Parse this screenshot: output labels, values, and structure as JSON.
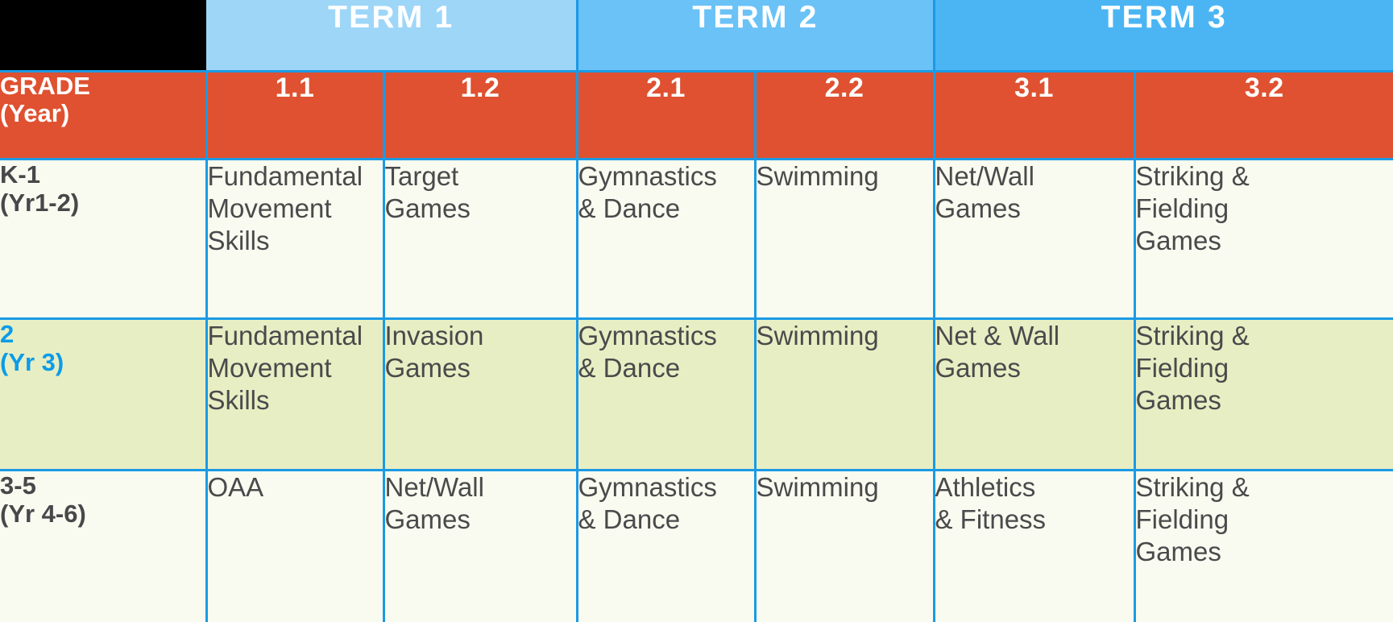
{
  "theme": {
    "grid_line": "#1b9ae5",
    "term1_bg": "#9ed6f8",
    "term2_bg": "#6ac2f6",
    "term3_bg": "#4bb5f4",
    "subheader_bg": "#df5130",
    "row_plain_bg": "#fafbf0",
    "row_highlight_bg": "#e8eec3",
    "body_text": "#4a4a4c",
    "highlight_text": "#0b9ce9",
    "header_text": "#ffffff",
    "corner_bg": "#000000"
  },
  "terms": [
    {
      "label": "TERM 1",
      "span": 2
    },
    {
      "label": "TERM 2",
      "span": 2
    },
    {
      "label": "TERM 3",
      "span": 2
    }
  ],
  "grade_header": {
    "line1": "GRADE",
    "line2": "(Year)"
  },
  "units": [
    "1.1",
    "1.2",
    "2.1",
    "2.2",
    "3.1",
    "3.2"
  ],
  "rows": [
    {
      "highlight": false,
      "grade_line1": "K-1",
      "grade_line2": "(Yr1-2)",
      "cells": [
        "Fundamental\nMovement\nSkills",
        "Target\nGames",
        "Gymnastics\n& Dance",
        "Swimming",
        "Net/Wall\nGames",
        "Striking &\nFielding\nGames"
      ]
    },
    {
      "highlight": true,
      "grade_line1": "2",
      "grade_line2": "(Yr 3)",
      "cells": [
        "Fundamental\nMovement\nSkills",
        "Invasion\nGames",
        "Gymnastics\n& Dance",
        "Swimming",
        "Net & Wall\nGames",
        "Striking &\nFielding\nGames"
      ]
    },
    {
      "highlight": false,
      "grade_line1": "3-5",
      "grade_line2": "(Yr 4-6)",
      "cells": [
        "OAA",
        "Net/Wall\nGames",
        "Gymnastics\n& Dance",
        "Swimming",
        "Athletics\n& Fitness",
        "Striking &\nFielding\nGames"
      ]
    }
  ]
}
